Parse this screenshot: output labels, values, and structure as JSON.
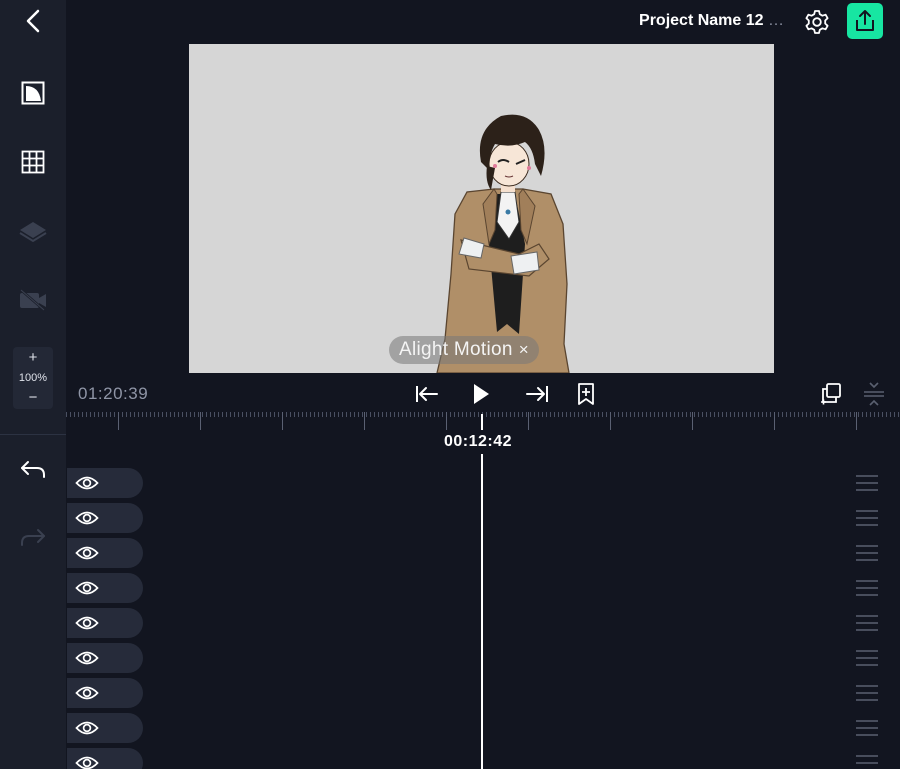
{
  "header": {
    "project_name": "Project Name 12",
    "project_name_overflow": "…",
    "back_icon": "chevron-left-icon",
    "settings_icon": "gear-icon",
    "export_icon": "share-export-icon",
    "accent_color": "#17e6a2"
  },
  "sidebar": {
    "tools": [
      {
        "name": "aspect-ratio-icon",
        "enabled": true
      },
      {
        "name": "grid-icon",
        "enabled": true
      },
      {
        "name": "layers-icon",
        "enabled": false
      },
      {
        "name": "camera-off-icon",
        "enabled": false
      }
    ],
    "zoom": {
      "plus": "+",
      "value": "100%",
      "minus": "−"
    },
    "undo_icon": "undo-icon",
    "redo_icon": "redo-icon"
  },
  "canvas": {
    "background_color": "#d6d6d6",
    "watermark_text": "Alight Motion",
    "watermark_close": "×"
  },
  "transport": {
    "total_time": "01:20:39",
    "buttons": [
      "skip-to-start-icon",
      "play-icon",
      "skip-to-end-icon",
      "bookmark-add-icon"
    ],
    "right_buttons": [
      "duplicate-icon",
      "collapse-icon"
    ]
  },
  "timeline": {
    "playhead_time": "00:12:42",
    "layers": [
      {
        "visible": true
      },
      {
        "visible": true
      },
      {
        "visible": true
      },
      {
        "visible": true
      },
      {
        "visible": true
      },
      {
        "visible": true
      },
      {
        "visible": true
      },
      {
        "visible": true
      },
      {
        "visible": true
      }
    ]
  }
}
